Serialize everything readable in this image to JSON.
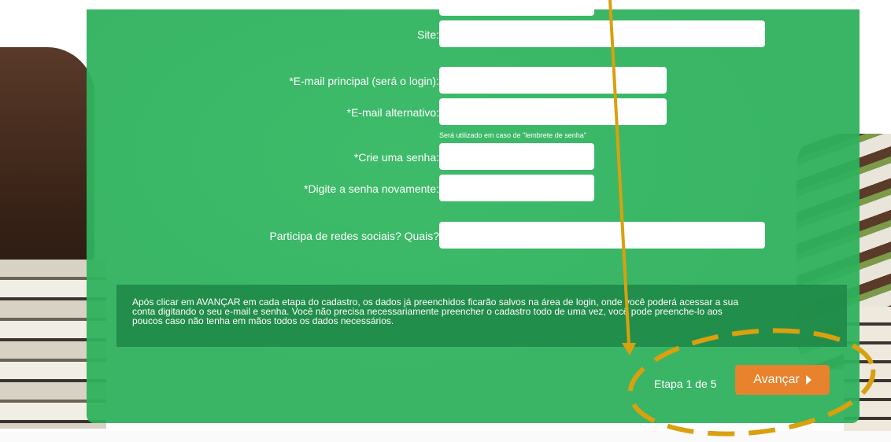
{
  "form": {
    "fields": [
      {
        "label": "Site:",
        "value": "",
        "placeholder": ""
      },
      {
        "label": "*E-mail principal (será o login):",
        "value": "",
        "placeholder": ""
      },
      {
        "label": "*E-mail alternativo:",
        "value": "",
        "placeholder": ""
      },
      {
        "label": "*Crie uma senha:",
        "value": "",
        "placeholder": ""
      },
      {
        "label": "*Digite a senha novamente:",
        "value": "",
        "placeholder": ""
      },
      {
        "label": "Participa de redes sociais? Quais?",
        "value": "",
        "placeholder": ""
      }
    ],
    "alt_email_hint": "Será utilizado em caso de \"lembrete de senha\""
  },
  "notice": {
    "line1": "Após clicar em AVANÇAR em cada etapa do cadastro, os dados já preenchidos ficarão salvos na área de login, onde você poderá acessar a sua",
    "line2": "conta digitando o seu e-mail e senha. Você não precisa necessariamente preencher o cadastro todo de uma vez, você pode preenche-lo aos",
    "line3": "poucos caso não tenha em mãos todos os dados necessários."
  },
  "footer": {
    "step_text": "Etapa 1 de 5",
    "next_label": "Avançar"
  },
  "colors": {
    "panel_green": "#2eb15d",
    "notice_green": "#1f8746",
    "button_orange": "#e9822c",
    "annotation_gold": "#d9a00f"
  },
  "icons": {
    "next": "caret-right-icon"
  }
}
